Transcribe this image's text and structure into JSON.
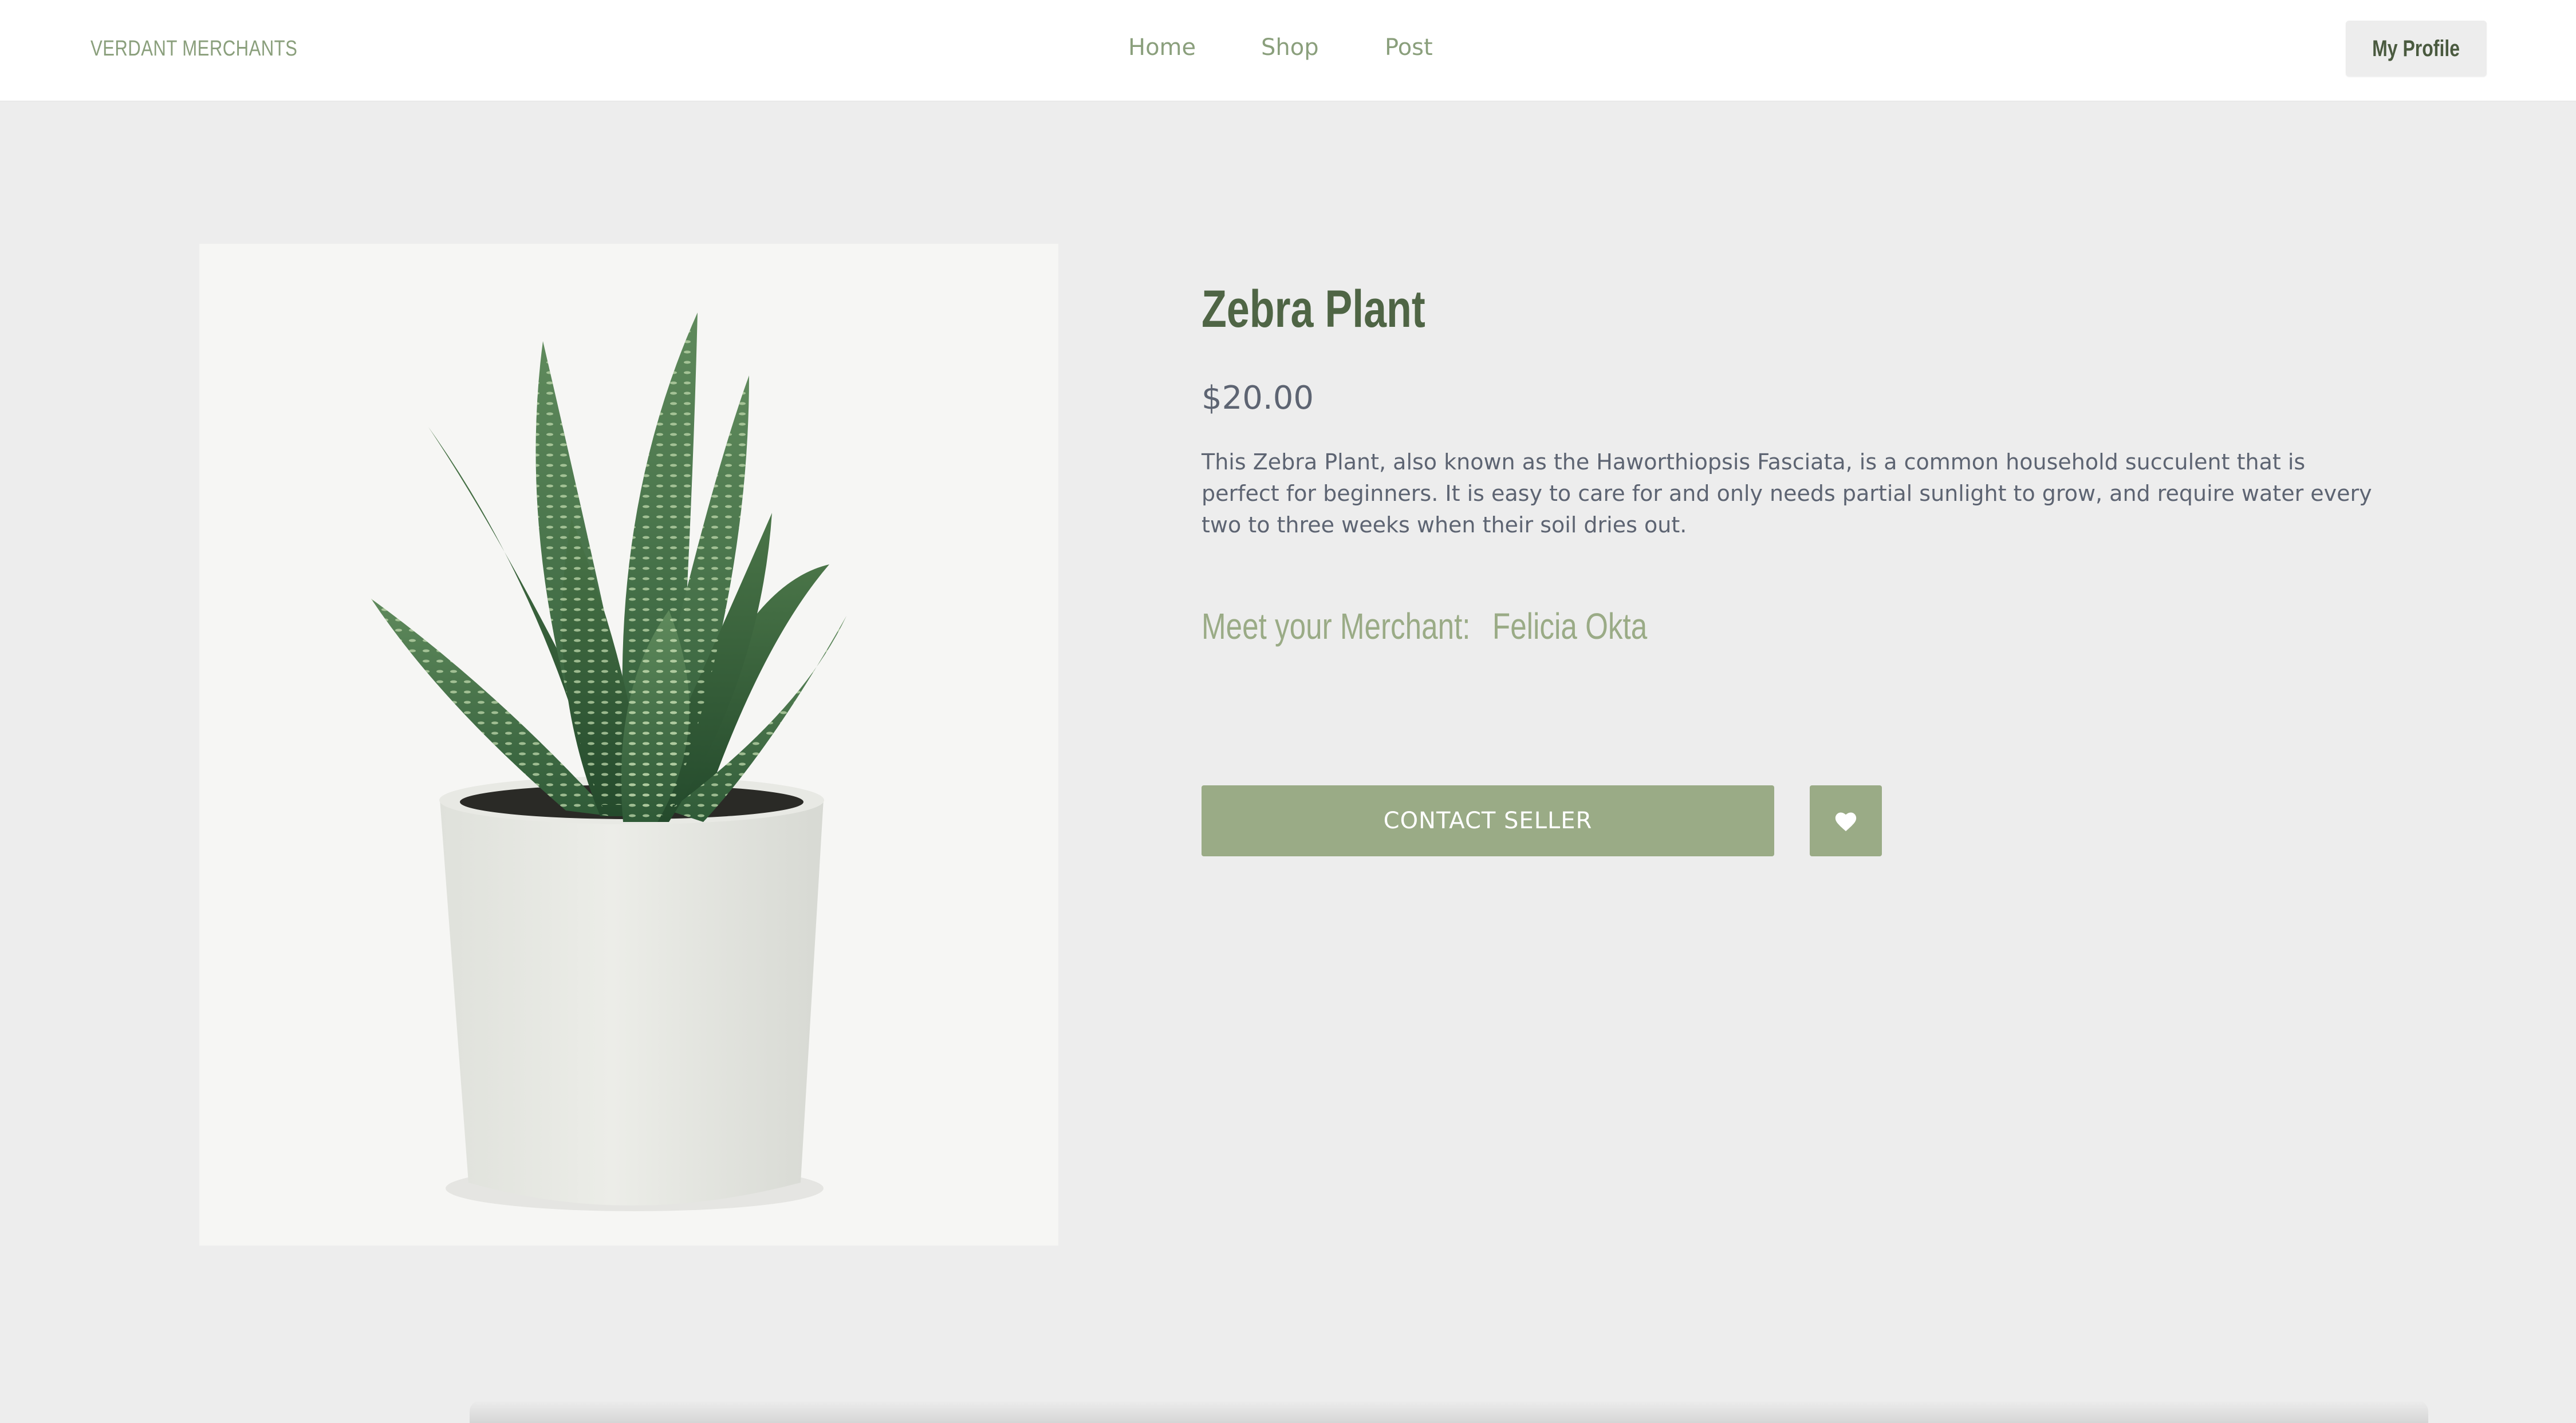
{
  "header": {
    "brand": "VERDANT MERCHANTS",
    "nav": [
      "Home",
      "Shop",
      "Post"
    ],
    "profile_label": "My Profile"
  },
  "product": {
    "image_alt_subject": "succulent in white pot",
    "title": "Zebra Plant",
    "price": "$20.00",
    "description": "This Zebra Plant, also known as the Haworthiopsis Fasciata, is a common household succulent that is perfect for beginners. It is easy to care for and only needs partial sunlight to grow, and require water every two to three weeks when their soil dries out.",
    "merchant_label": "Meet your Merchant:",
    "merchant_name": "Felicia Okta",
    "contact_label": "CONTACT SELLER",
    "favorite_icon": "heart-icon"
  },
  "colors": {
    "accent": "#9aab86",
    "brand_text": "#8a9f7c",
    "title_text": "#4f6545",
    "body_text": "#5d6472",
    "page_bg": "#ededed"
  }
}
